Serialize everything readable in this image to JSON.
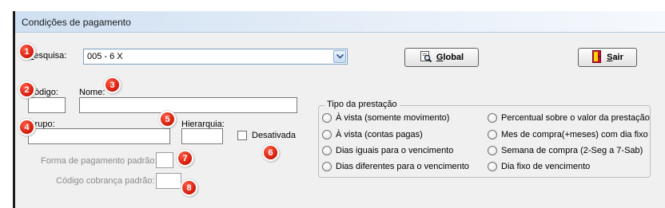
{
  "window": {
    "title": "Condições de pagamento"
  },
  "search": {
    "label": "Pesquisa:",
    "value": "005 - 6 X"
  },
  "buttons": {
    "global_label": "Global",
    "sair_label": "Sair"
  },
  "fields": {
    "codigo_label": "Código:",
    "nome_label": "Nome:",
    "grupo_label": "Grupo:",
    "hierarquia_label": "Hierarquia:",
    "desativada_label": "Desativada",
    "forma_pagamento_label": "Forma de pagamento padrão:",
    "codigo_cobranca_label": "Código cobrança padrão:"
  },
  "tipo_prestacao": {
    "legend": "Tipo da prestação",
    "options": [
      "À vista  (somente movimento)",
      "À vista  (contas pagas)",
      "Dias iguais para o vencimento",
      "Dias diferentes para o vencimento",
      "Percentual sobre o valor da prestação",
      "Mes de compra(+meses) com dia fixo",
      "Semana de compra (2-Seg a 7-Sab)",
      "Dia fixo de vencimento"
    ]
  },
  "badges": [
    "1",
    "2",
    "3",
    "4",
    "5",
    "6",
    "7",
    "8"
  ],
  "colors": {
    "badge": "#e0220f",
    "title_gradient_start": "#cfe0f2",
    "panel": "#f0f0f0"
  },
  "icons": {
    "global": "magnifier-document-icon",
    "sair": "exit-door-icon",
    "combo": "chevron-down-icon"
  }
}
